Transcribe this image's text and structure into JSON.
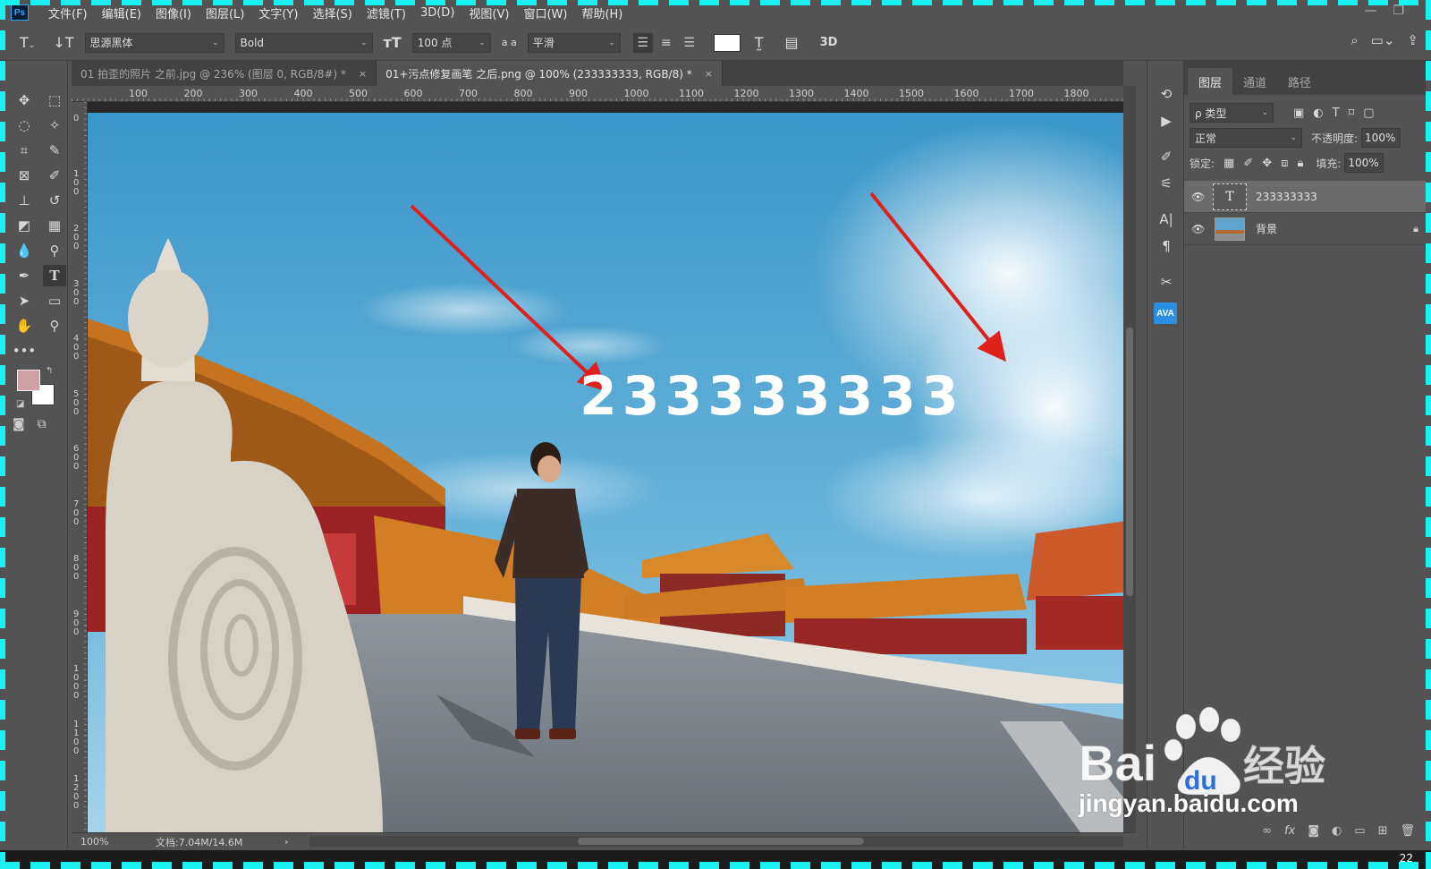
{
  "app": {
    "logo": "Ps"
  },
  "menu": [
    "文件(F)",
    "编辑(E)",
    "图像(I)",
    "图层(L)",
    "文字(Y)",
    "选择(S)",
    "滤镜(T)",
    "3D(D)",
    "视图(V)",
    "窗口(W)",
    "帮助(H)"
  ],
  "options": {
    "font_family": "思源黑体",
    "font_style": "Bold",
    "font_size": "100 点",
    "aa_label": "a a",
    "antialias": "平滑",
    "threed": "3D"
  },
  "tabs": [
    {
      "label": "01 拍歪的照片 之前.jpg @ 236% (图层 0, RGB/8#) *",
      "close": "×"
    },
    {
      "label": "01+污点修复画笔 之后.png @ 100% (233333333, RGB/8) *",
      "close": "×"
    }
  ],
  "ruler": {
    "h_labels": [
      "100",
      "200",
      "300",
      "400",
      "500",
      "600",
      "700",
      "800",
      "900",
      "1000",
      "1100",
      "1200",
      "1300",
      "1400",
      "1500",
      "1600",
      "1700",
      "1800"
    ],
    "v_labels": [
      "0",
      "100",
      "200",
      "300",
      "400",
      "500",
      "600",
      "700",
      "800",
      "900",
      "1000",
      "1100",
      "1200"
    ]
  },
  "canvas": {
    "text_layer_content": "233333333"
  },
  "status": {
    "zoom": "100%",
    "doc_info": "文档:7.04M/14.6M",
    "arrow": "›"
  },
  "layers_panel": {
    "tabs": [
      "图层",
      "通道",
      "路径"
    ],
    "filter_label": "ρ 类型",
    "blend_mode": "正常",
    "opacity_label": "不透明度:",
    "opacity_value": "100%",
    "lock_label": "锁定:",
    "fill_label": "填充:",
    "fill_value": "100%",
    "layers": [
      {
        "name": "233333333",
        "type": "text",
        "selected": true
      },
      {
        "name": "背景",
        "type": "image",
        "locked": true
      }
    ],
    "footer_fx": "fx"
  },
  "mini_panel": {
    "ava": "AVA"
  },
  "watermark": {
    "brand": "Bai",
    "brand_du": "du",
    "brand_cn": "经验",
    "url": "jingyan.baidu.com"
  },
  "clock": "22",
  "colors": {
    "foreground": "#d0a0a7",
    "background": "#ffffff",
    "accent": "#31a8ff",
    "arrow": "#e0201a"
  }
}
